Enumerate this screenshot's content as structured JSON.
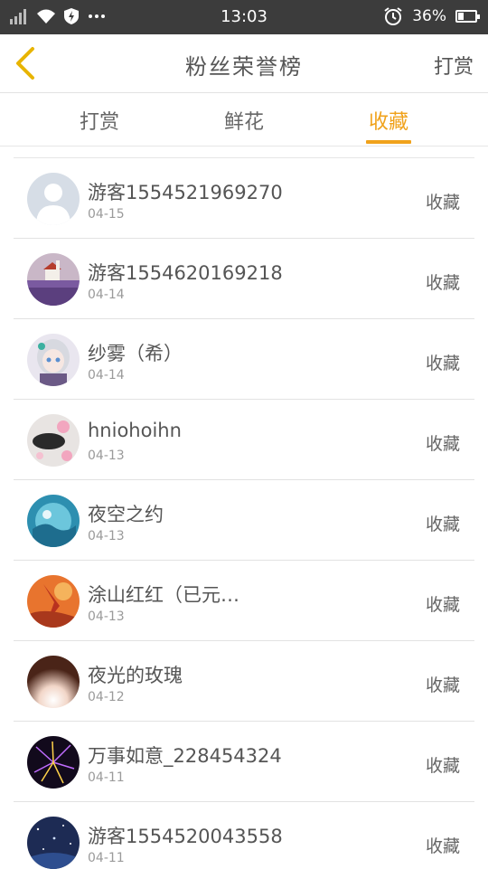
{
  "status_bar": {
    "time": "13:03",
    "battery": "36%",
    "battery_level": 0.36,
    "icons": [
      "signal-icon",
      "wifi-icon",
      "shield-icon",
      "more-icon",
      "alarm-icon",
      "battery-icon"
    ]
  },
  "header": {
    "title": "粉丝荣誉榜",
    "action": "打赏",
    "back_icon": "chevron-left-icon"
  },
  "tabs": [
    {
      "label": "打赏",
      "active": false
    },
    {
      "label": "鲜花",
      "active": false
    },
    {
      "label": "收藏",
      "active": true
    }
  ],
  "colors": {
    "accent": "#f0a21b",
    "status_bar": "#3c3c3c"
  },
  "list": [
    {
      "name": "游客1554521969270",
      "date": "04-15",
      "action": "收藏",
      "avatar": "default-user"
    },
    {
      "name": "游客1554620169218",
      "date": "04-14",
      "action": "收藏",
      "avatar": "landscape"
    },
    {
      "name": "纱雾（希）",
      "date": "04-14",
      "action": "收藏",
      "avatar": "anime-girl"
    },
    {
      "name": "hniohoihn",
      "date": "04-13",
      "action": "收藏",
      "avatar": "flowers-dark"
    },
    {
      "name": "夜空之约",
      "date": "04-13",
      "action": "收藏",
      "avatar": "sea-blue"
    },
    {
      "name": "涂山红红（已元…",
      "date": "04-13",
      "action": "收藏",
      "avatar": "red-character"
    },
    {
      "name": "夜光的玫瑰",
      "date": "04-12",
      "action": "收藏",
      "avatar": "dark-glow"
    },
    {
      "name": "万事如意_228454324",
      "date": "04-11",
      "action": "收藏",
      "avatar": "fireworks"
    },
    {
      "name": "游客1554520043558",
      "date": "04-11",
      "action": "收藏",
      "avatar": "night-sky"
    }
  ]
}
